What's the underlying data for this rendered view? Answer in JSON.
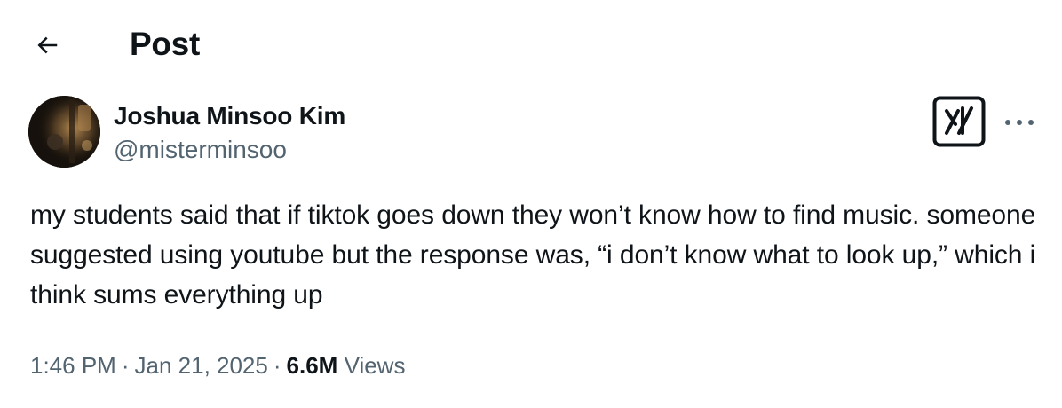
{
  "header": {
    "back_icon": "arrow-left-icon",
    "title": "Post"
  },
  "author": {
    "name": "Joshua Minsoo Kim",
    "handle": "@misterminsoo",
    "avatar_icon": "user-avatar"
  },
  "actions": {
    "grok_icon": "grok-icon",
    "more_icon": "more-dots-icon"
  },
  "tweet": {
    "text": "my students said that if tiktok goes down they won’t know how to find music. someone suggested using youtube but the response was, “i don’t know what to look up,” which i think sums everything up"
  },
  "meta": {
    "time": "1:46 PM",
    "separator": "·",
    "date": "Jan 21, 2025",
    "views_count": "6.6M",
    "views_label": "Views"
  },
  "colors": {
    "text_primary": "#0f1419",
    "text_secondary": "#536471",
    "background": "#ffffff"
  }
}
